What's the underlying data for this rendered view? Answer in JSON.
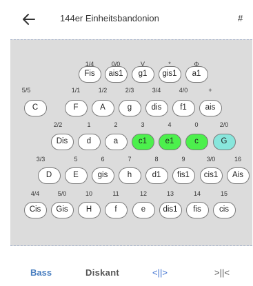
{
  "header": {
    "title": "144er Einheitsbandonion",
    "menu_label": "#"
  },
  "colors": {
    "green": "#4cf04c",
    "cyan": "#88e6dc"
  },
  "rows": [
    {
      "keys": [
        {
          "num": "1/4",
          "label": "Fis"
        },
        {
          "num": "0/0",
          "label": "ais1"
        },
        {
          "num": "V",
          "label": "g1"
        },
        {
          "num": "*",
          "label": "gis1"
        },
        {
          "num": "Φ",
          "label": "a1"
        }
      ]
    },
    {
      "keys": [
        {
          "num": "5/5",
          "label": "C"
        },
        {
          "num": "1/1",
          "label": "F"
        },
        {
          "num": "1/2",
          "label": "A"
        },
        {
          "num": "2/3",
          "label": "g"
        },
        {
          "num": "3/4",
          "label": "dis"
        },
        {
          "num": "4/0",
          "label": "f1"
        },
        {
          "num": "+",
          "label": "ais"
        }
      ]
    },
    {
      "keys": [
        {
          "num": "2/2",
          "label": "Dis"
        },
        {
          "num": "1",
          "label": "d"
        },
        {
          "num": "2",
          "label": "a"
        },
        {
          "num": "3",
          "label": "c1",
          "highlight": "green"
        },
        {
          "num": "4",
          "label": "e1",
          "highlight": "green"
        },
        {
          "num": "0",
          "label": "c",
          "highlight": "green"
        },
        {
          "num": "2/0",
          "label": "G",
          "highlight": "cyan"
        }
      ]
    },
    {
      "keys": [
        {
          "num": "3/3",
          "label": "D"
        },
        {
          "num": "5",
          "label": "E"
        },
        {
          "num": "6",
          "label": "gis"
        },
        {
          "num": "7",
          "label": "h"
        },
        {
          "num": "8",
          "label": "d1"
        },
        {
          "num": "9",
          "label": "fis1"
        },
        {
          "num": "3/0",
          "label": "cis1"
        },
        {
          "num": "16",
          "label": "Ais"
        }
      ]
    },
    {
      "keys": [
        {
          "num": "4/4",
          "label": "Cis"
        },
        {
          "num": "5/0",
          "label": "Gis"
        },
        {
          "num": "10",
          "label": "H"
        },
        {
          "num": "11",
          "label": "f"
        },
        {
          "num": "12",
          "label": "e"
        },
        {
          "num": "13",
          "label": "dis1"
        },
        {
          "num": "14",
          "label": "fis"
        },
        {
          "num": "15",
          "label": "cis"
        }
      ]
    }
  ],
  "bottom_tabs": {
    "bass": "Bass",
    "diskant": "Diskant",
    "mid": "<||>",
    "right": ">||<"
  }
}
